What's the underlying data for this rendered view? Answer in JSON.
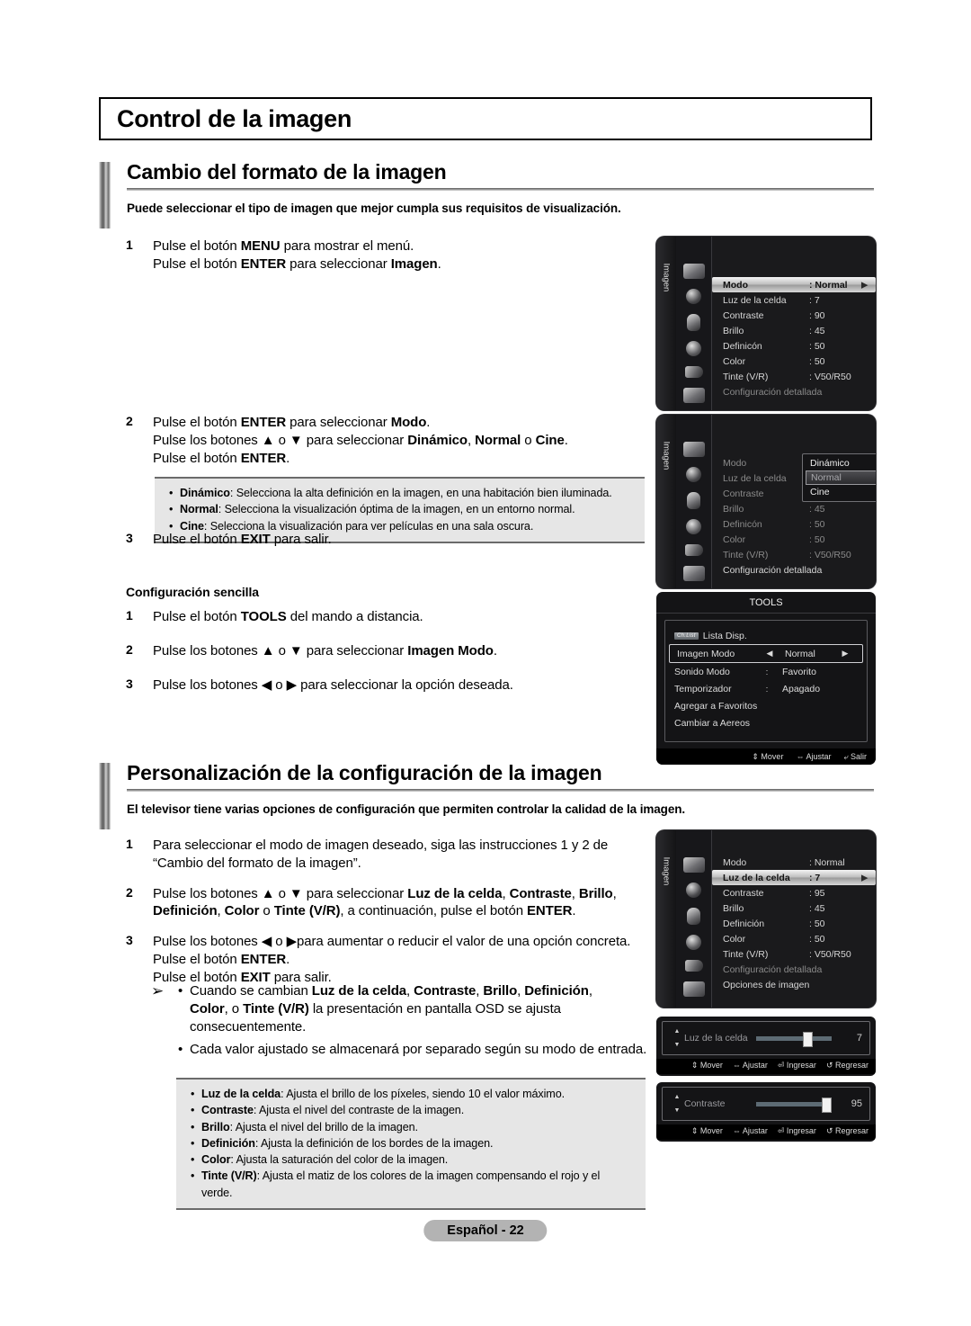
{
  "page": {
    "title": "Control de la imagen",
    "footer": "Español - 22"
  },
  "section1": {
    "heading": "Cambio del formato de la imagen",
    "lead": "Puede seleccionar el tipo de imagen que mejor cumpla sus requisitos de visualización.",
    "steps": [
      {
        "num": "1",
        "line1_a": "Pulse el botón ",
        "line1_b": "MENU",
        "line1_c": " para mostrar el menú.",
        "line2_a": "Pulse el botón ",
        "line2_b": "ENTER",
        "line2_c": " para seleccionar ",
        "line2_d": "Imagen",
        "line2_e": "."
      },
      {
        "num": "2"
      },
      {
        "num": "3"
      }
    ],
    "step2": {
      "l1_a": "Pulse el botón ",
      "l1_b": "ENTER",
      "l1_c": " para seleccionar ",
      "l1_d": "Modo",
      "l1_e": ".",
      "l2_a": "Pulse los botones ▲ o ▼ para seleccionar ",
      "l2_b": "Dinámico",
      "l2_c": ", ",
      "l2_d": "Normal",
      "l2_e": " o ",
      "l2_f": "Cine",
      "l2_g": ".",
      "l3_a": "Pulse el botón ",
      "l3_b": "ENTER",
      "l3_c": "."
    },
    "step3": {
      "a": "Pulse el botón ",
      "b": "EXIT",
      "c": " para salir."
    },
    "modes_note": [
      {
        "term": "Dinámico",
        "desc": ": Selecciona la alta definición en la imagen, en una habitación bien iluminada."
      },
      {
        "term": "Normal",
        "desc": ": Selecciona la visualización óptima de la imagen, en un entorno normal."
      },
      {
        "term": "Cine",
        "desc": ": Selecciona la visualización para ver películas en una sala oscura."
      }
    ],
    "simple_setup": {
      "title": "Configuración sencilla",
      "steps": [
        {
          "num": "1",
          "a": "Pulse el botón ",
          "b": "TOOLS",
          "c": " del mando a distancia.",
          "d": "",
          "e": ""
        },
        {
          "num": "2",
          "a": "Pulse los botones ▲ o ▼ para seleccionar ",
          "b": "Imagen Modo",
          "c": ".",
          "d": "",
          "e": ""
        },
        {
          "num": "3",
          "a": "Pulse los botones ◀ o ▶ para seleccionar la opción deseada.",
          "b": "",
          "c": "",
          "d": "",
          "e": ""
        }
      ]
    }
  },
  "section2": {
    "heading": "Personalización de la configuración de la imagen",
    "lead": "El televisor tiene varias opciones de configuración que permiten controlar la calidad de la imagen.",
    "step1": {
      "num": "1",
      "l1": "Para seleccionar el modo de imagen deseado, siga las instrucciones 1 y 2 de",
      "l2": "“Cambio del formato de la imagen”."
    },
    "step2": {
      "num": "2",
      "l1_a": "Pulse los botones ▲ o ▼ para seleccionar ",
      "l1_b": "Luz de la celda",
      "l1_c": ", ",
      "l1_d": "Contraste",
      "l1_e": ", ",
      "l1_f": "Brillo",
      "l1_g": ",",
      "l2_a": "Definición",
      "l2_b": ", ",
      "l2_c": "Color",
      "l2_d": " o ",
      "l2_e": "Tinte (V/R)",
      "l2_f": ", a continuación, pulse el botón ",
      "l2_g": "ENTER",
      "l2_h": "."
    },
    "step3": {
      "num": "3",
      "l1": "Pulse los botones ◀ o ▶para aumentar o reducir el valor de una opción concreta.",
      "l2_a": "Pulse el botón ",
      "l2_b": "ENTER",
      "l2_c": ".",
      "l3_a": "Pulse el botón ",
      "l3_b": "EXIT",
      "l3_c": " para salir."
    },
    "arrow_note": {
      "glyph": "➢",
      "b1_a": "Cuando se cambian ",
      "b1_b": "Luz de la celda",
      "b1_c": ", ",
      "b1_d": "Contraste",
      "b1_e": ", ",
      "b1_f": "Brillo",
      "b1_g": ", ",
      "b1_h": "Definición",
      "b1_i": ",",
      "b1_j": "Color",
      "b1_k": ", o ",
      "b1_l": "Tinte (V/R)",
      "b1_m": " la presentación en pantalla OSD se ajusta",
      "b1_n": "consecuentemente.",
      "b2": "Cada valor ajustado se almacenará por separado según su modo de entrada."
    },
    "params_note": [
      {
        "term": "Luz de la celda",
        "desc": ": Ajusta el brillo de los píxeles, siendo 10 el valor máximo."
      },
      {
        "term": "Contraste",
        "desc": ": Ajusta el nivel del contraste de la imagen."
      },
      {
        "term": "Brillo",
        "desc": ": Ajusta el nivel del brillo de la imagen."
      },
      {
        "term": "Definición",
        "desc": ": Ajusta la definición de los bordes de la imagen."
      },
      {
        "term": "Color",
        "desc": ": Ajusta la saturación del color de la imagen."
      },
      {
        "term": "Tinte (V/R)",
        "desc": ": Ajusta el matiz de los colores de la imagen compensando el rojo y el"
      },
      {
        "term": "",
        "desc": "verde."
      }
    ]
  },
  "osd1": {
    "side_tab": "Imagen",
    "rows": [
      {
        "label": "Modo",
        "value": ": Normal",
        "selected": true,
        "dim": false
      },
      {
        "label": "Luz de la celda",
        "value": ": 7",
        "selected": false,
        "dim": false
      },
      {
        "label": "Contraste",
        "value": ": 90",
        "selected": false,
        "dim": false
      },
      {
        "label": "Brillo",
        "value": ": 45",
        "selected": false,
        "dim": false
      },
      {
        "label": "Definicón",
        "value": ": 50",
        "selected": false,
        "dim": false
      },
      {
        "label": "Color",
        "value": ": 50",
        "selected": false,
        "dim": false
      },
      {
        "label": "Tinte (V/R)",
        "value": ": V50/R50",
        "selected": false,
        "dim": false
      },
      {
        "label": "Configuración detallada",
        "value": "",
        "selected": false,
        "dim": true
      }
    ],
    "caret": "▶"
  },
  "osd2": {
    "side_tab": "Imagen",
    "rows": [
      {
        "label": "Modo",
        "value": ":",
        "selected": false,
        "dim": true
      },
      {
        "label": "Luz de la celda",
        "value": ":",
        "selected": false,
        "dim": true
      },
      {
        "label": "Contraste",
        "value": ":",
        "selected": false,
        "dim": true
      },
      {
        "label": "Brillo",
        "value": ": 45",
        "selected": false,
        "dim": true
      },
      {
        "label": "Definicón",
        "value": ": 50",
        "selected": false,
        "dim": true
      },
      {
        "label": "Color",
        "value": ": 50",
        "selected": false,
        "dim": true
      },
      {
        "label": "Tinte (V/R)",
        "value": ": V50/R50",
        "selected": false,
        "dim": true
      },
      {
        "label": "Configuración detallada",
        "value": "",
        "selected": false,
        "dim": false
      }
    ],
    "popup": [
      {
        "label": "Dinámico",
        "highlight": false
      },
      {
        "label": "Normal",
        "highlight": true
      },
      {
        "label": "Cine",
        "highlight": false
      }
    ]
  },
  "tools": {
    "title": "TOOLS",
    "chip_label": "Ch.List",
    "rows": [
      {
        "label": "Lista Disp.",
        "mid": "",
        "value": "",
        "right": "",
        "selected": false,
        "chip": true
      },
      {
        "label": "Imagen Modo",
        "mid": "◀",
        "value": "Normal",
        "right": "▶",
        "selected": true,
        "chip": false
      },
      {
        "label": "Sonido Modo",
        "mid": ":",
        "value": "Favorito",
        "right": "",
        "selected": false,
        "chip": false
      },
      {
        "label": "Temporizador",
        "mid": ":",
        "value": "Apagado",
        "right": "",
        "selected": false,
        "chip": false
      },
      {
        "label": "Agregar a Favoritos",
        "mid": "",
        "value": "",
        "right": "",
        "selected": false,
        "chip": false
      },
      {
        "label": "Cambiar a Aereos",
        "mid": "",
        "value": "",
        "right": "",
        "selected": false,
        "chip": false
      }
    ],
    "footer": [
      "⇕ Mover",
      "⇔ Ajustar",
      "⤶ Salir"
    ]
  },
  "osd3": {
    "side_tab": "Imagen",
    "rows": [
      {
        "label": "Modo",
        "value": ": Normal",
        "selected": false,
        "dim": false
      },
      {
        "label": "Luz de la celda",
        "value": ": 7",
        "selected": true,
        "dim": false
      },
      {
        "label": "Contraste",
        "value": ": 95",
        "selected": false,
        "dim": false
      },
      {
        "label": "Brillo",
        "value": ": 45",
        "selected": false,
        "dim": false
      },
      {
        "label": "Definición",
        "value": ": 50",
        "selected": false,
        "dim": false
      },
      {
        "label": "Color",
        "value": ": 50",
        "selected": false,
        "dim": false
      },
      {
        "label": "Tinte (V/R)",
        "value": ": V50/R50",
        "selected": false,
        "dim": false
      },
      {
        "label": "Configuración detallada",
        "value": "",
        "selected": false,
        "dim": true
      },
      {
        "label": "Opciones de imagen",
        "value": "",
        "selected": false,
        "dim": false
      }
    ],
    "caret": "▶"
  },
  "slider1": {
    "label": "Luz de la celda",
    "value": "7",
    "percent": 68,
    "footer": [
      "⇕ Mover",
      "⇔ Ajustar",
      "⏎ Ingresar",
      "↺ Regresar"
    ]
  },
  "slider2": {
    "label": "Contraste",
    "value": "95",
    "percent": 93,
    "footer": [
      "⇕ Mover",
      "⇔ Ajustar",
      "⏎ Ingresar",
      "↺ Regresar"
    ]
  }
}
